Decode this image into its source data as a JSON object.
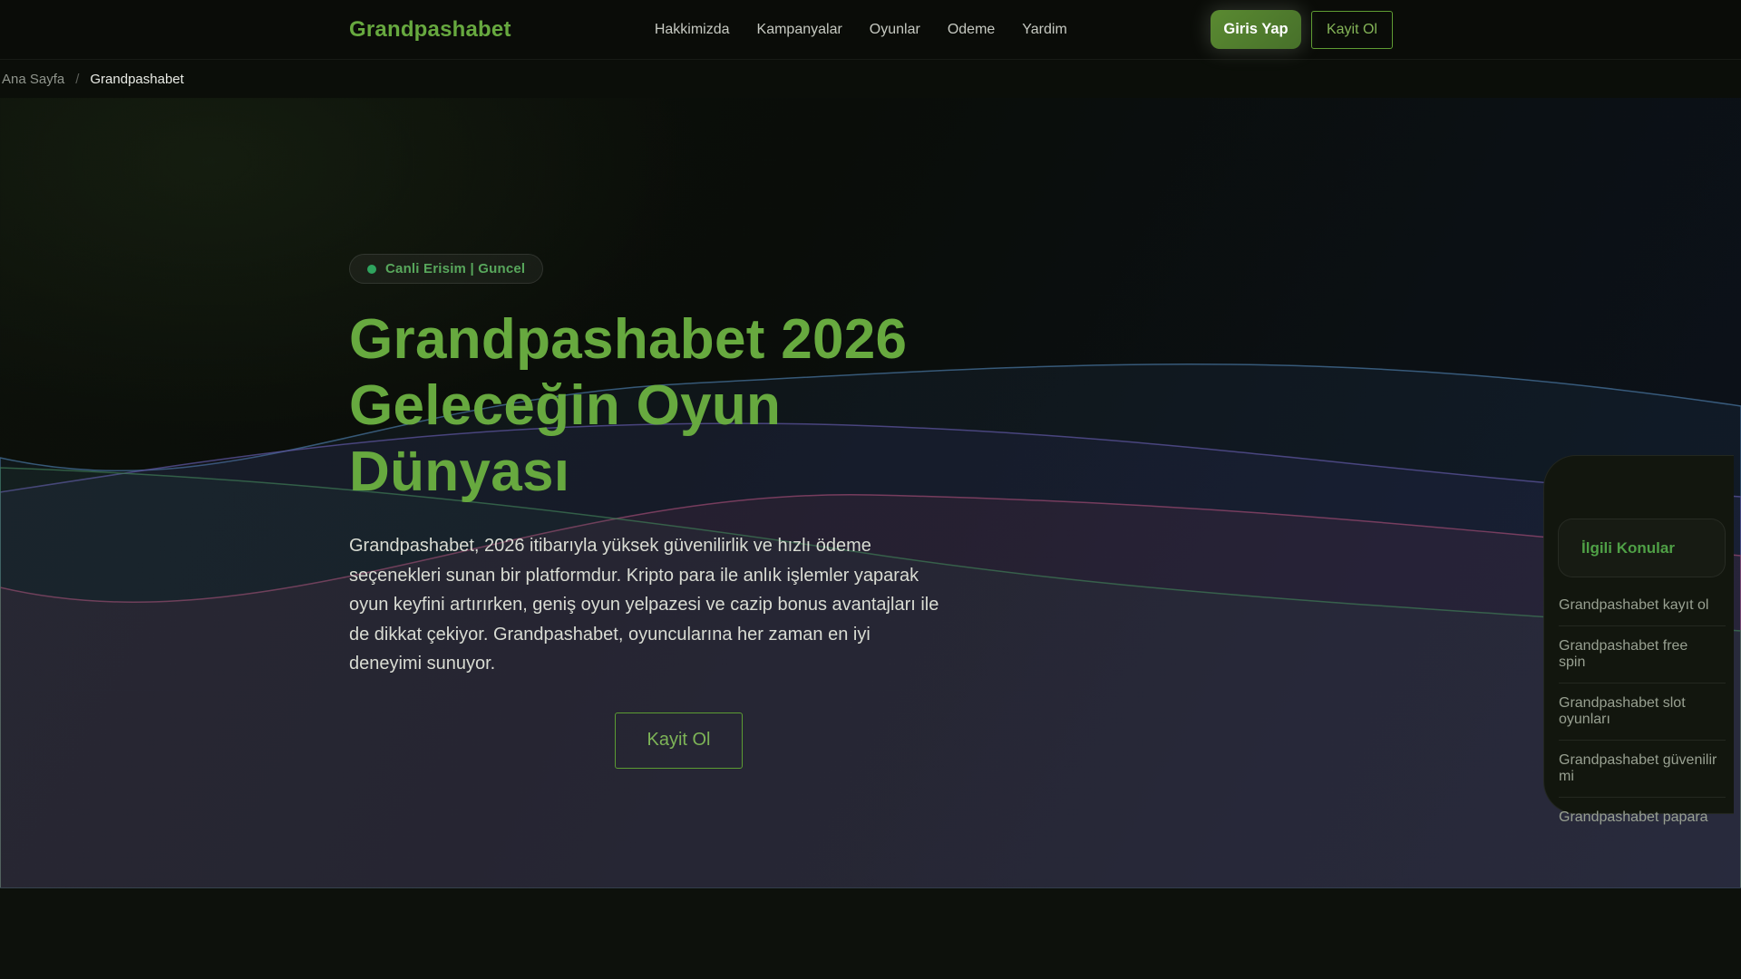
{
  "brand": {
    "logo": "Grandpashabet"
  },
  "nav": {
    "links": [
      "Hakkimizda",
      "Kampanyalar",
      "Oyunlar",
      "Odeme",
      "Yardim"
    ],
    "login_label": "Giris Yap",
    "register_label": "Kayit Ol"
  },
  "breadcrumb": {
    "home": "Ana Sayfa",
    "separator": "/",
    "current": "Grandpashabet"
  },
  "hero": {
    "badge_label": "Canli Erisim | Guncel",
    "title": "Grandpashabet 2026 Geleceğin Oyun Dünyası",
    "description": "Grandpashabet, 2026 itibarıyla yüksek güvenilirlik ve hızlı ödeme seçenekleri sunan bir platformdur. Kripto para ile anlık işlemler yaparak oyun keyfini artırırken, geniş oyun yelpazesi ve cazip bonus avantajları ile de dikkat çekiyor. Grandpashabet, oyuncularına her zaman en iyi deneyimi sunuyor.",
    "cta_label": "Kayit Ol"
  },
  "sidebar": {
    "title": "İlgili Konular",
    "items": [
      "Grandpashabet kayıt ol",
      "Grandpashabet free spin",
      "Grandpashabet slot oyunları",
      "Grandpashabet güvenilir mi",
      "Grandpashabet papara"
    ]
  },
  "colors": {
    "accent-green": "#67a93f",
    "badge-dot": "#2fa45e",
    "login-btn-green": "#4f7c2d",
    "wave-blue": "#45719b",
    "wave-purple": "#5c549e",
    "wave-pink": "#9c4a72",
    "wave-green": "#3f7a55"
  }
}
